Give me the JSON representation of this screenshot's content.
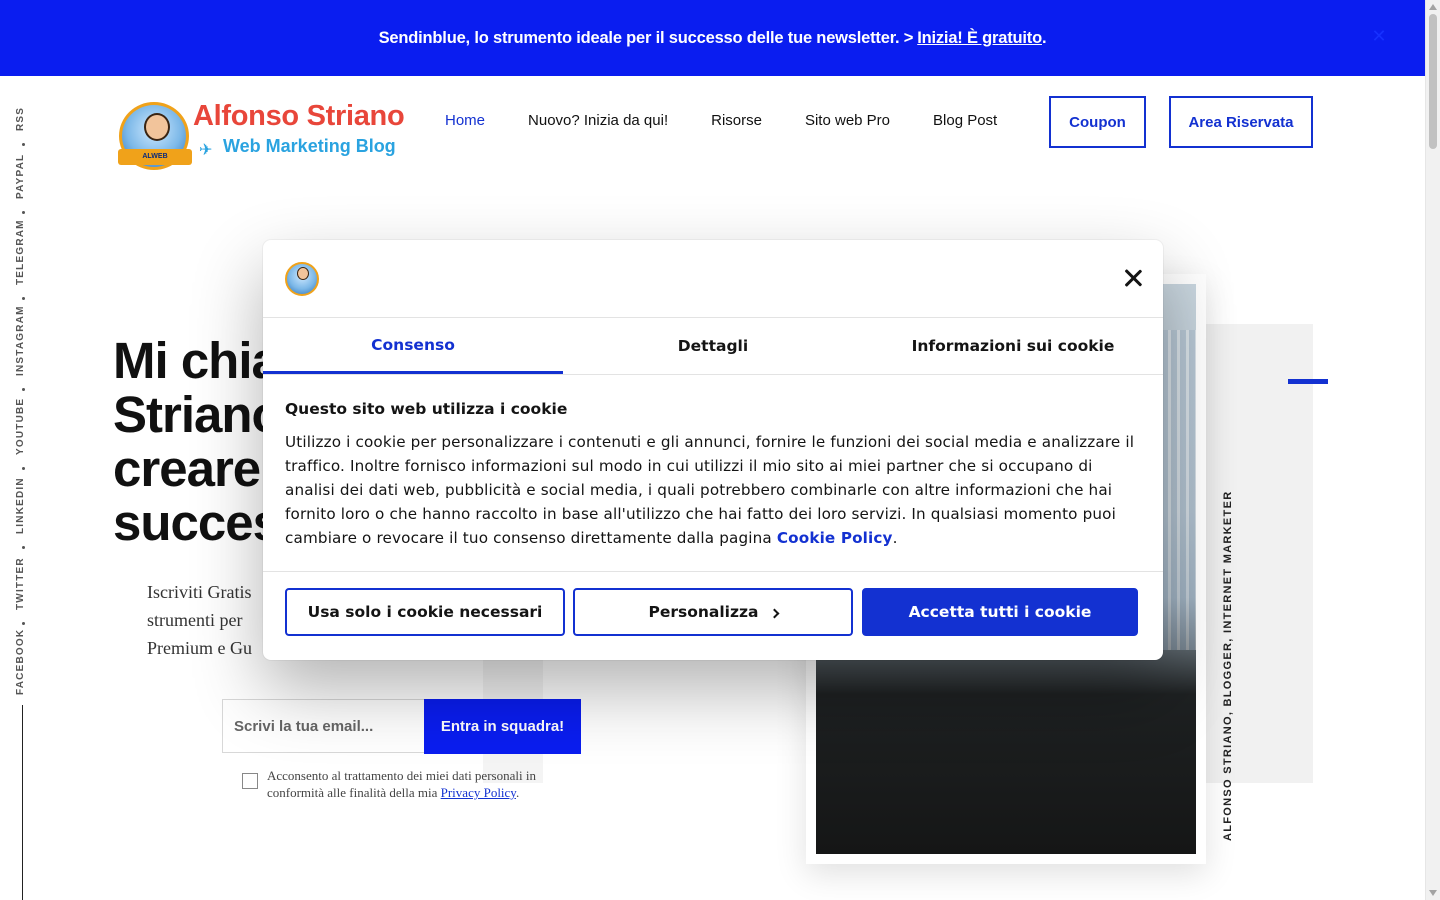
{
  "promo": {
    "text": "Sendinblue, lo strumento ideale per il successo delle tue newsletter. >",
    "link": "Inizia! È gratuito",
    "after": ".",
    "close_icon": "close-icon"
  },
  "social": [
    "RSS",
    "PAYPAL",
    "TELEGRAM",
    "INSTAGRAM",
    "YOUTUBE",
    "LINKEDIN",
    "TWITTER",
    "FACEBOOK"
  ],
  "logo": {
    "title": "Alfonso Striano",
    "subtitle": "Web Marketing Blog",
    "badge_text": "ALWEB"
  },
  "nav": {
    "items": [
      "Home",
      "Nuovo? Inizia da qui!",
      "Risorse",
      "Sito web Pro ",
      "Blog Post"
    ],
    "active": "Home",
    "coupon": "Coupon",
    "area": "Area Riservata"
  },
  "hero": {
    "line1": "Mi chia",
    "line2": "Striano",
    "line3": "creare",
    "line4": "success",
    "text1": "Iscriviti Gratis",
    "text2": "strumenti per",
    "text3": "Premium e Gu",
    "email_placeholder": "Scrivi la tua email...",
    "submit": "Entra in squadra!",
    "consent_text": "Acconsento al trattamento dei miei dati personali in conformità alle finalità della mia",
    "consent_link": "Privacy Policy",
    "consent_after": "."
  },
  "caption": "ALFONSO STRIANO, BLOGGER, INTERNET MARKETER",
  "cookie": {
    "tabs": [
      "Consenso",
      "Dettagli",
      "Informazioni sui cookie"
    ],
    "active_tab": "Consenso",
    "heading": "Questo sito web utilizza i cookie",
    "body": "Utilizzo i cookie per personalizzare i contenuti e gli annunci, fornire le funzioni dei social media e analizzare il traffico. Inoltre fornisco informazioni sul modo in cui utilizzi il mio sito ai miei partner che si occupano di analisi dei dati web, pubblicità e social media, i quali potrebbero combinarle con altre informazioni che hai fornito loro o che hanno raccolto in base all'utilizzo che hai fatto dei loro servizi. In qualsiasi momento puoi cambiare o revocare il tuo consenso direttamente dalla pagina",
    "body_link": "Cookie Policy",
    "body_after": ".",
    "btn_necessary": "Usa solo i cookie necessari",
    "btn_customize": "Personalizza",
    "btn_accept": "Accetta tutti i cookie"
  },
  "colors": {
    "brand_blue": "#0a1df0",
    "accent_blue": "#1331d1",
    "logo_red": "#e8463a",
    "logo_cyan": "#2aa3e0"
  }
}
